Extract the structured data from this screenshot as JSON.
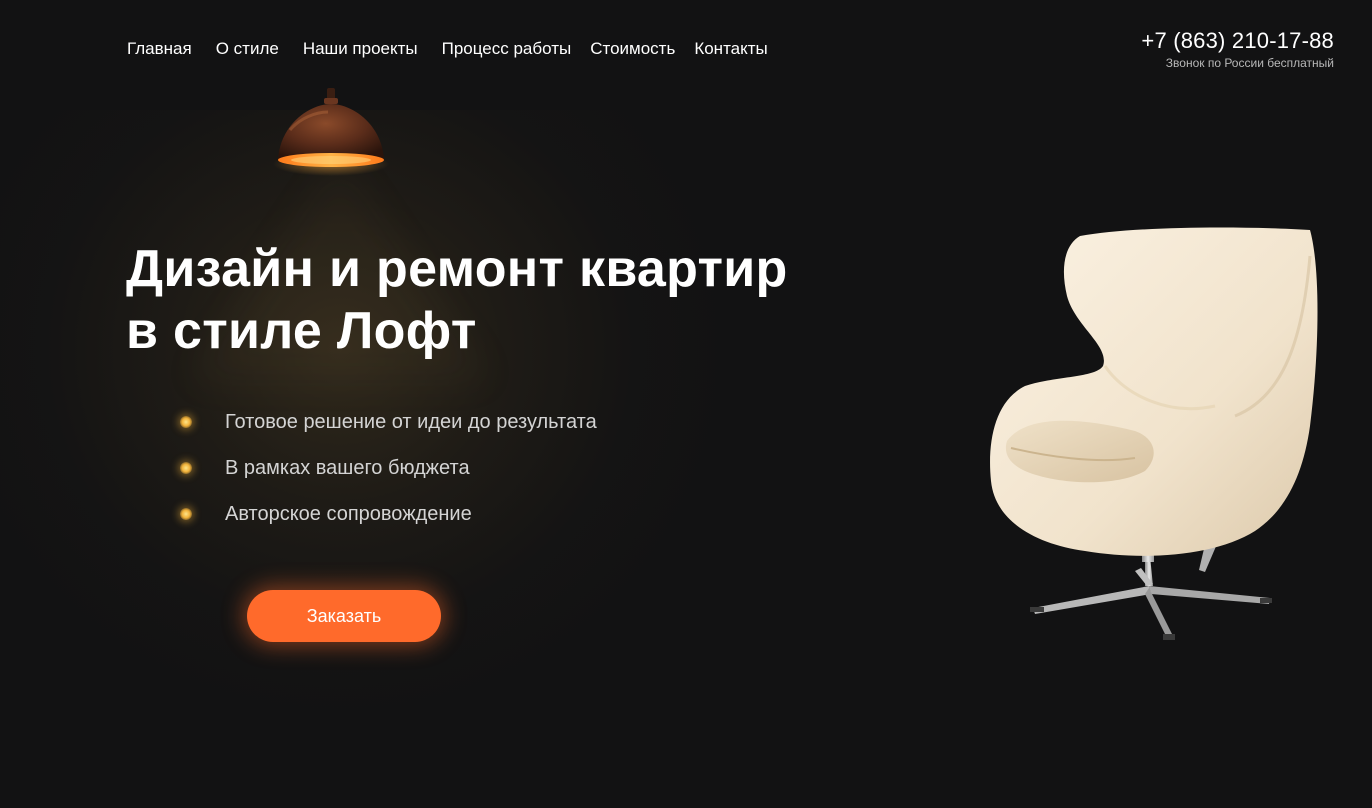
{
  "nav": {
    "items": [
      {
        "label": "Главная"
      },
      {
        "label": "О стиле"
      },
      {
        "label": "Наши проекты"
      },
      {
        "label": "Процесс работы"
      },
      {
        "label": "Стоимость"
      },
      {
        "label": "Контакты"
      }
    ]
  },
  "contact": {
    "phone": "+7 (863) 210-17-88",
    "phone_note": "Звонок по России бесплатный"
  },
  "hero": {
    "title_line1": "Дизайн и ремонт квартир",
    "title_line2": "в стиле Лофт",
    "features": [
      {
        "text": "Готовое решение от идеи до результата"
      },
      {
        "text": "В рамках вашего бюджета"
      },
      {
        "text": "Авторское сопровождение"
      }
    ],
    "cta_label": "Заказать"
  },
  "images": {
    "lamp": "pendant-lamp-icon",
    "chair": "egg-chair-icon"
  },
  "colors": {
    "background": "#121213",
    "accent": "#ff6a2b",
    "bullet": "#f2b23a",
    "text": "#ffffff",
    "muted": "#d4d4d4"
  }
}
